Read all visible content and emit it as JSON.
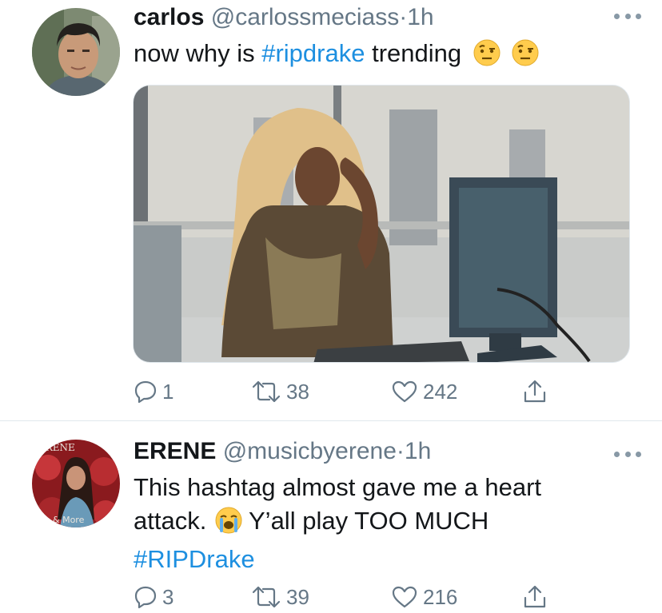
{
  "tweets": [
    {
      "name": "carlos",
      "handle": "@carlossmeciass",
      "dot": "·",
      "time": "1h",
      "text_before": "now why is ",
      "hashtag": "#ripdrake",
      "text_after": " trending",
      "emoji": "face-with-raised-eyebrow-icon",
      "counts": {
        "replies": "1",
        "retweets": "38",
        "likes": "242"
      }
    },
    {
      "name": "ERENE",
      "handle": "@musicbyerene",
      "dot": "·",
      "time": "1h",
      "text_before": "This hashtag almost gave me a heart attack.",
      "text_after": " Y’all play TOO MUCH",
      "emoji": "loudly-crying-face-icon",
      "hashtag": "#RIPDrake",
      "avatar_text": {
        "top": "ERENE",
        "bottom": "& More"
      },
      "counts": {
        "replies": "3",
        "retweets": "39",
        "likes": "216"
      }
    }
  ],
  "colors": {
    "link": "#1d8fe0",
    "secondary_text": "#657786",
    "divider": "#e1e8ed"
  }
}
